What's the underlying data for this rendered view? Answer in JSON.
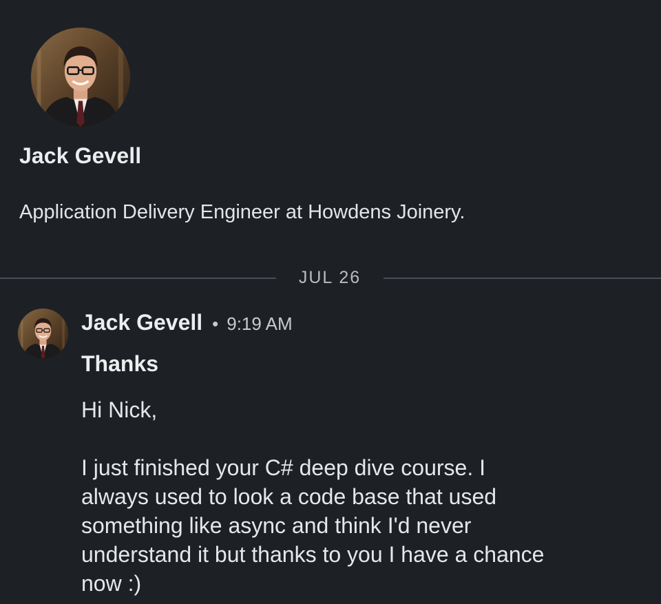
{
  "profile": {
    "name": "Jack Gevell",
    "headline": "Application Delivery Engineer at Howdens Joinery."
  },
  "divider": {
    "date": "JUL 26"
  },
  "message": {
    "sender": "Jack Gevell",
    "separator": "•",
    "time": "9:19 AM",
    "subject": "Thanks",
    "greeting": "Hi Nick,",
    "body_lines": [
      "I just finished your C# deep dive course. I",
      "always used to look a code base that used",
      "something like async and think I'd never",
      "understand it but thanks to you I have a chance",
      "now :)"
    ]
  },
  "colors": {
    "background": "#1d2126",
    "text_primary": "#ecedee",
    "text_secondary": "#c8cacd",
    "divider": "#4a4f55"
  },
  "icons": {
    "profile_avatar": "profile-photo",
    "message_avatar": "profile-photo"
  }
}
